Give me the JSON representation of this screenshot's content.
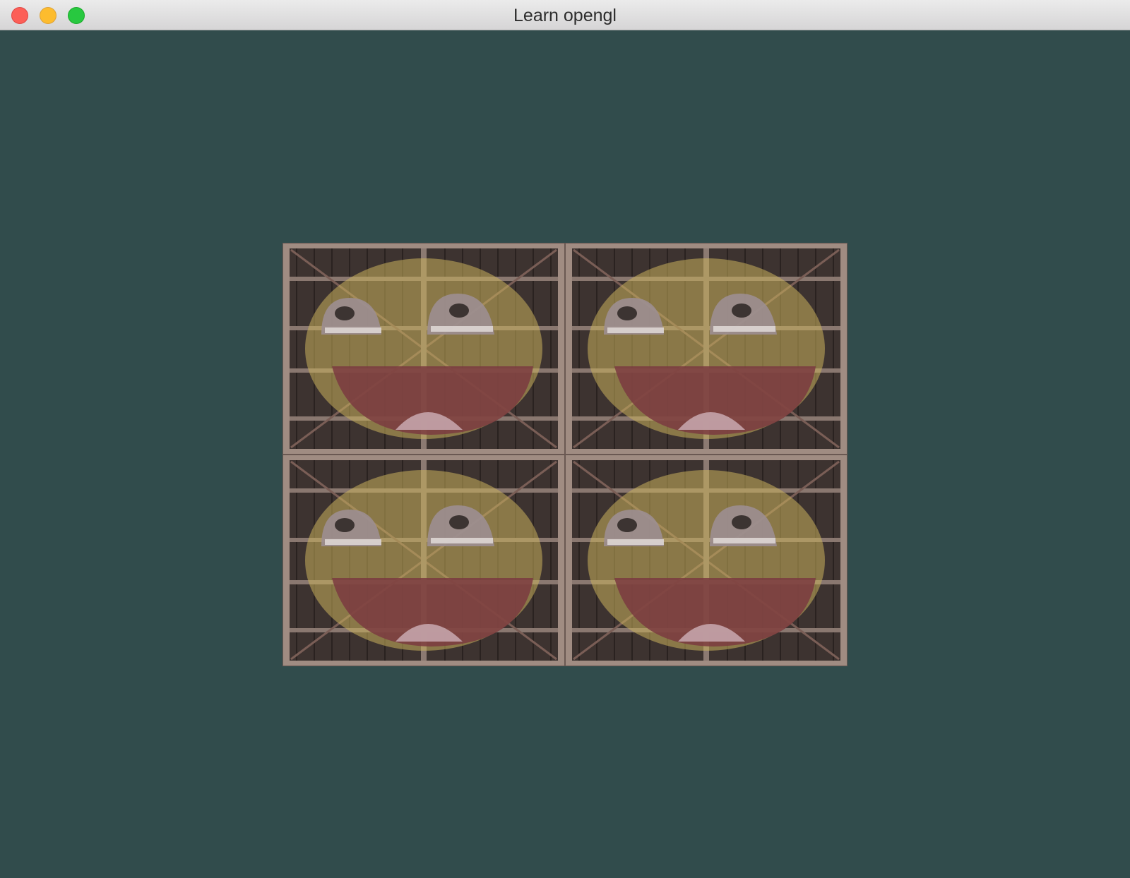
{
  "window": {
    "title": "Learn opengl",
    "controls": {
      "close": "close-button",
      "minimize": "minimize-button",
      "zoom": "zoom-button"
    }
  },
  "viewport": {
    "clear_color": "#314c4c",
    "texture_repeat": {
      "columns": 2,
      "rows": 2
    }
  },
  "colors": {
    "close": "#fc5f57",
    "minimize": "#fdbc2e",
    "zoom": "#28c840",
    "wood_dark": "#3a2f2c",
    "wood_frame": "#a08c82",
    "face_yellow": "#c8b05a",
    "mouth_red": "#7a3a40"
  }
}
